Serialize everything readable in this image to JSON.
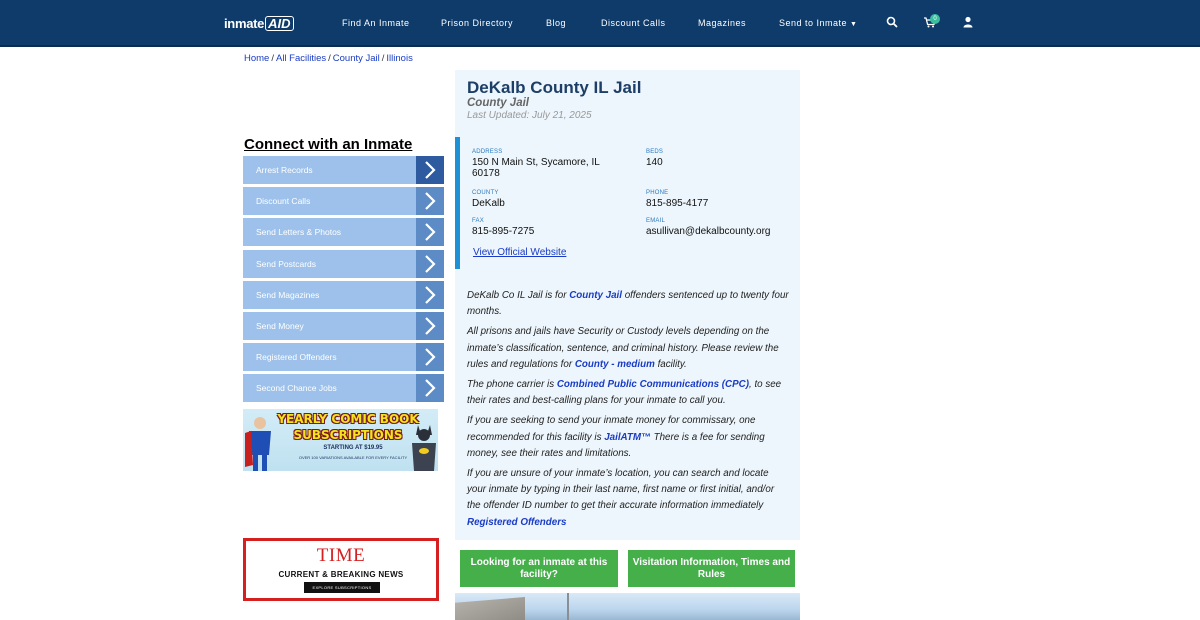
{
  "header": {
    "logo_part1": "inmate",
    "logo_part2": "AID",
    "nav": [
      {
        "label": "Find An Inmate"
      },
      {
        "label": "Prison Directory"
      },
      {
        "label": "Blog"
      },
      {
        "label": "Discount Calls"
      },
      {
        "label": "Magazines"
      },
      {
        "label": "Send to Inmate"
      }
    ],
    "cart_count": "0",
    "icons": [
      "search-icon",
      "cart-icon",
      "user-icon",
      "caret-down-icon"
    ]
  },
  "breadcrumb": [
    "Home",
    "All Facilities",
    "County Jail",
    "Illinois"
  ],
  "sidebar": {
    "title": "Connect with an Inmate",
    "items": [
      {
        "label": "Arrest Records"
      },
      {
        "label": "Discount Calls"
      },
      {
        "label": "Send Letters & Photos"
      },
      {
        "label": "Send Postcards"
      },
      {
        "label": "Send Magazines"
      },
      {
        "label": "Send Money"
      },
      {
        "label": "Registered Offenders"
      },
      {
        "label": "Second Chance Jobs"
      }
    ]
  },
  "ads": {
    "comic": {
      "line1": "YEARLY COMIC BOOK",
      "line2": "SUBSCRIPTIONS",
      "line3": "STARTING AT $19.95",
      "line4": "OVER 100 VARIATIONS AVAILABLE FOR EVERY FACILITY"
    },
    "time": {
      "logo": "TIME",
      "subtitle": "CURRENT & BREAKING NEWS",
      "button": "EXPLORE SUBSCRIPTIONS"
    }
  },
  "facility": {
    "title": "DeKalb County IL Jail",
    "type": "County Jail",
    "updated": "Last Updated: July 21, 2025",
    "fields": {
      "address_label": "ADDRESS",
      "address": "150 N Main St, Sycamore, IL 60178",
      "beds_label": "BEDS",
      "beds": "140",
      "county_label": "COUNTY",
      "county": "DeKalb",
      "phone_label": "PHONE",
      "phone": "815-895-4177",
      "fax_label": "FAX",
      "fax": "815-895-7275",
      "email_label": "EMAIL",
      "email": "asullivan@dekalbcounty.org"
    },
    "website_link": "View Official Website"
  },
  "description": {
    "p1_a": "DeKalb Co IL Jail is for ",
    "p1_link": "County Jail",
    "p1_b": " offenders sentenced up to twenty four months.",
    "p2_a": "All prisons and jails have Security or Custody levels depending on the inmate’s classification, sentence, and criminal history. Please review the rules and regulations for ",
    "p2_link": "County - medium",
    "p2_b": " facility.",
    "p3_a": "The phone carrier is ",
    "p3_link": "Combined Public Communications (CPC)",
    "p3_b": ", to see their rates and best-calling plans for your inmate to call you.",
    "p4_a": "If you are seeking to send your inmate money for commissary, one recommended for this facility is ",
    "p4_link": "JailATM™",
    "p4_b": " There is a fee for sending money, see their rates and limitations.",
    "p5_a": "If you are unsure of your inmate’s location, you can search and locate your inmate by typing in their last name, first name or first initial, and/or the offender ID number to get their accurate information immediately ",
    "p5_link": "Registered Offenders"
  },
  "buttons": {
    "find_inmate": "Looking for an inmate at this facility?",
    "visitation": "Visitation Information, Times and Rules"
  },
  "colors": {
    "nav_bg": "#0f3b6b",
    "accent_green": "#45b04a",
    "panel_bg": "#edf6fc",
    "link_blue": "#1a3cc4",
    "sidebar_item": "#9dc1ea",
    "info_border": "#1e90d6"
  }
}
